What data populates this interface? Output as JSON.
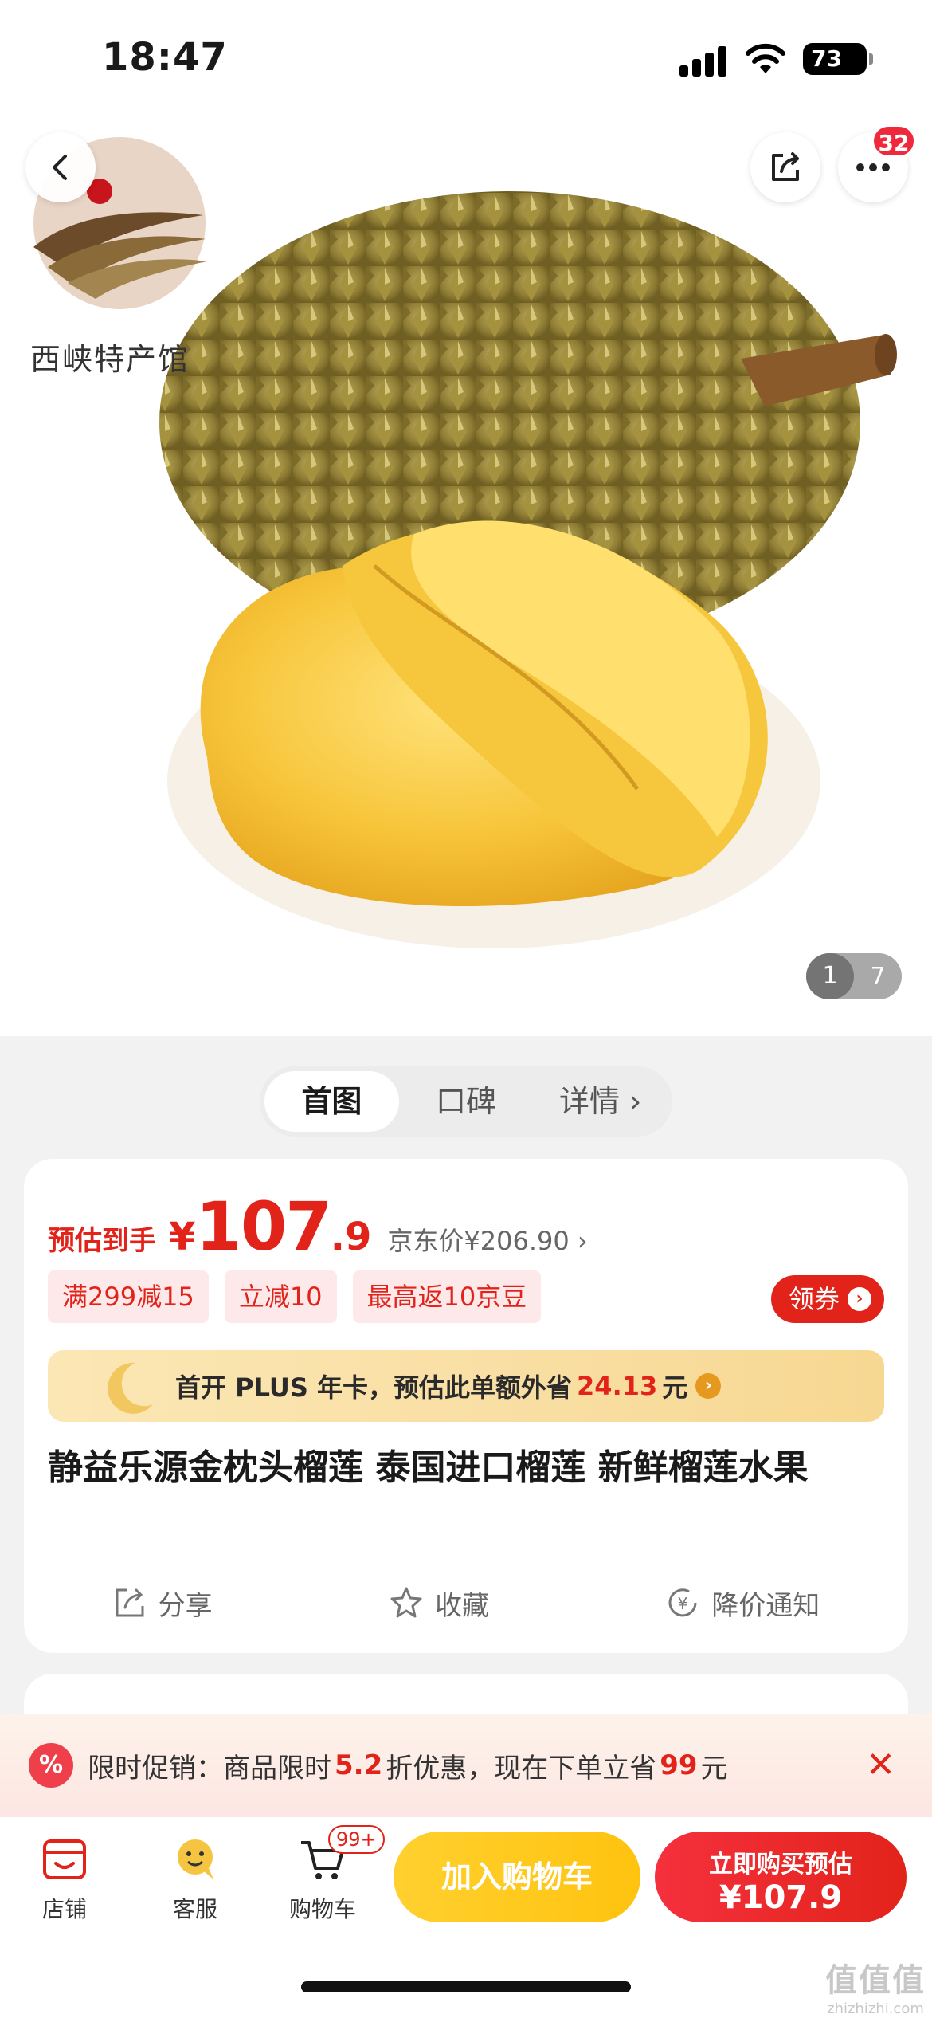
{
  "status_bar": {
    "time": "18:47",
    "battery": "73"
  },
  "header": {
    "more_badge": "32"
  },
  "store_logo": {
    "text": "西峡特产馆"
  },
  "gallery": {
    "current": "1",
    "total": "7"
  },
  "tabs": [
    {
      "label": "首图",
      "active": true
    },
    {
      "label": "口碑",
      "active": false
    },
    {
      "label": "详情 ›",
      "active": false
    }
  ],
  "price": {
    "label": "预估到手",
    "currency": "¥",
    "integer": "107",
    "decimal": ".9",
    "jd_price": "京东价¥206.90 ›"
  },
  "coupons": [
    "满299减15",
    "立减10",
    "最高返10京豆"
  ],
  "get_coupon_label": "领券",
  "plus_bar": {
    "text": "首开 PLUS 年卡，预估此单额外省",
    "amount": "24.13",
    "unit": "元"
  },
  "product": {
    "title": "静益乐源金枕头榴莲 泰国进口榴莲 新鲜榴莲水果"
  },
  "actions": [
    {
      "label": "分享",
      "icon": "share-icon"
    },
    {
      "label": "收藏",
      "icon": "star-icon"
    },
    {
      "label": "降价通知",
      "icon": "price-drop-icon"
    }
  ],
  "promo": {
    "prefix": "限时促销：商品限时",
    "discount": "5.2",
    "mid": "折优惠，现在下单立省",
    "save": "99",
    "suffix": "元",
    "icon": "%"
  },
  "bottom_bar": {
    "store": "店铺",
    "service": "客服",
    "cart": "购物车",
    "cart_badge": "99+",
    "add_cart": "加入购物车",
    "buy_line1": "立即购买预估",
    "buy_line2": "¥107.9"
  },
  "watermark": {
    "big": "值值值",
    "small": "zhizhizhi.com"
  },
  "colors": {
    "accent": "#e2231a",
    "gold": "#ffc30f",
    "plus_bg": "#fbe7b5"
  }
}
